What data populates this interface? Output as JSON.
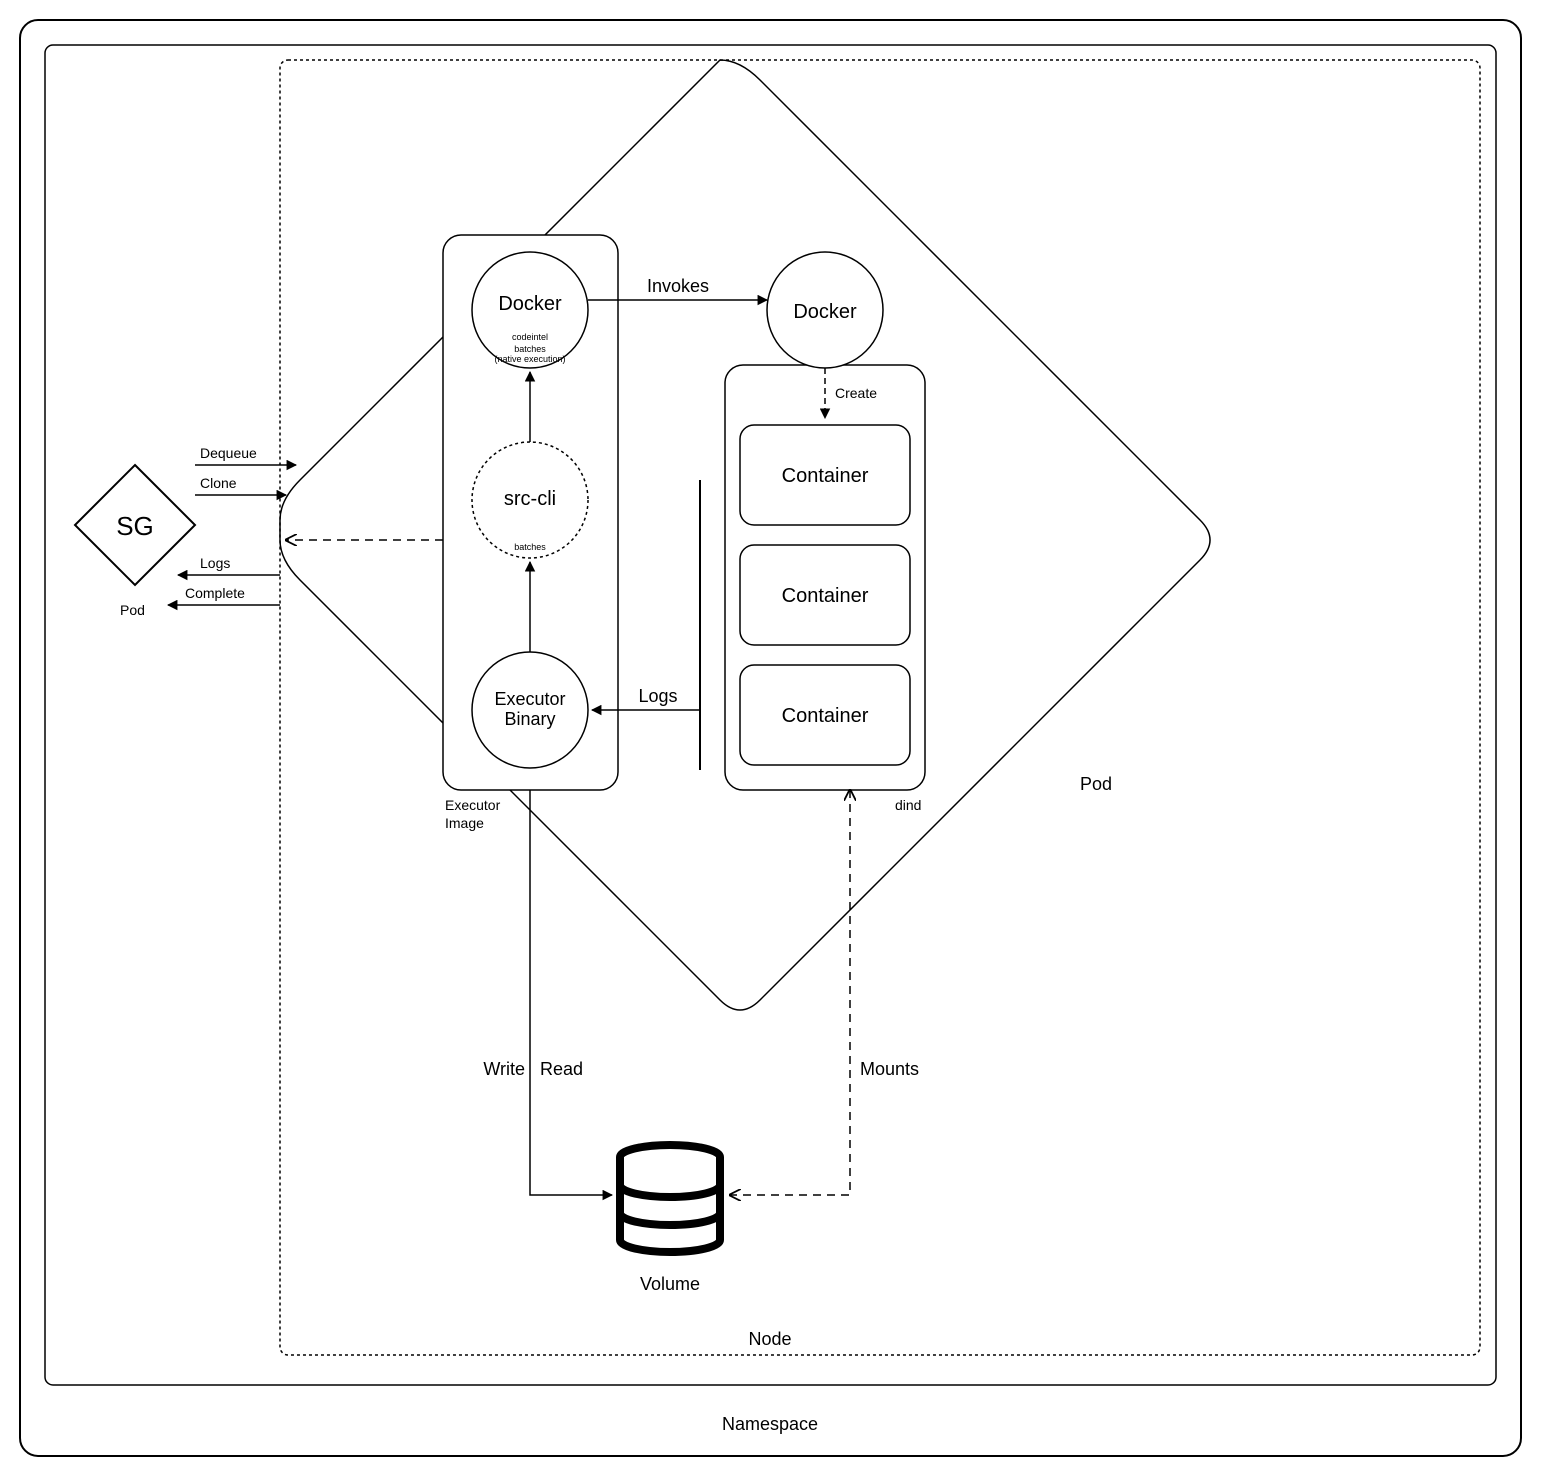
{
  "namespace_label": "Namespace",
  "node_label": "Node",
  "volume_label": "Volume",
  "sg_pod": {
    "title": "SG",
    "pod_label": "Pod"
  },
  "main_pod_label": "Pod",
  "executor_image": {
    "container_label": "Executor\nImage",
    "docker_label": "Docker",
    "docker_sub1": "codeintel",
    "docker_sub2": "batches\n(native execution)",
    "srccli_label": "src-cli",
    "srccli_sub": "batches",
    "executor_binary_label": "Executor\nBinary"
  },
  "dind": {
    "container_label": "dind",
    "docker_label": "Docker",
    "container1": "Container",
    "container2": "Container",
    "container3": "Container"
  },
  "edges": {
    "dequeue": "Dequeue",
    "clone": "Clone",
    "logs": "Logs",
    "complete": "Complete",
    "invokes": "Invokes",
    "create": "Create",
    "logs2": "Logs",
    "write": "Write",
    "read": "Read",
    "mounts": "Mounts"
  }
}
